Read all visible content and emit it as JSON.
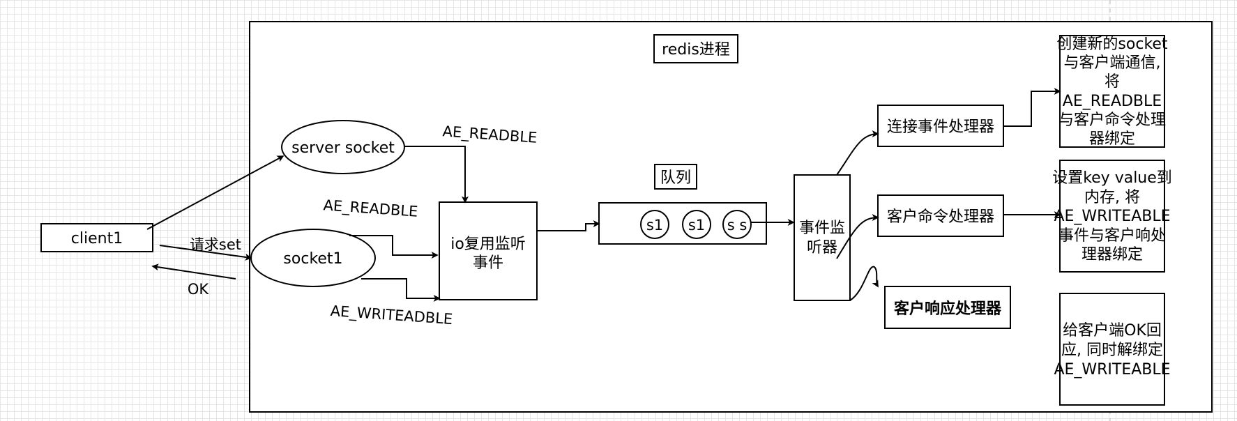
{
  "nodes": {
    "redis_process": "redis进程",
    "client": "client1",
    "server_socket": "server socket",
    "socket1": "socket1",
    "io_multiplexer": [
      "io复用监听",
      "事件"
    ],
    "queue_label": "队列",
    "queue_items": [
      "s1",
      "s1",
      "s s"
    ],
    "event_dispatcher": [
      "事件监",
      "听器"
    ],
    "connection_handler": "连接事件处理器",
    "command_handler": "客户命令处理器",
    "reply_handler": "客户响应处理器"
  },
  "edge_labels": {
    "request": "请求set",
    "ok": "OK",
    "server_readable": "AE_READBLE",
    "socket_readable": "AE_READBLE",
    "socket_writable": "AE_WRITEADBLE"
  },
  "notes": {
    "connection": [
      "创建新的socket",
      "与客户端通信,",
      "将",
      "AE_READBLE",
      "与客户命令处理",
      "器绑定"
    ],
    "command": [
      "设置key value到",
      "内存, 将",
      "AE_WRITEABLE",
      "事件与客户响处",
      "理器绑定"
    ],
    "reply": [
      "给客户端OK回",
      "应, 同时解绑定",
      "AE_WRITEABLE"
    ]
  }
}
